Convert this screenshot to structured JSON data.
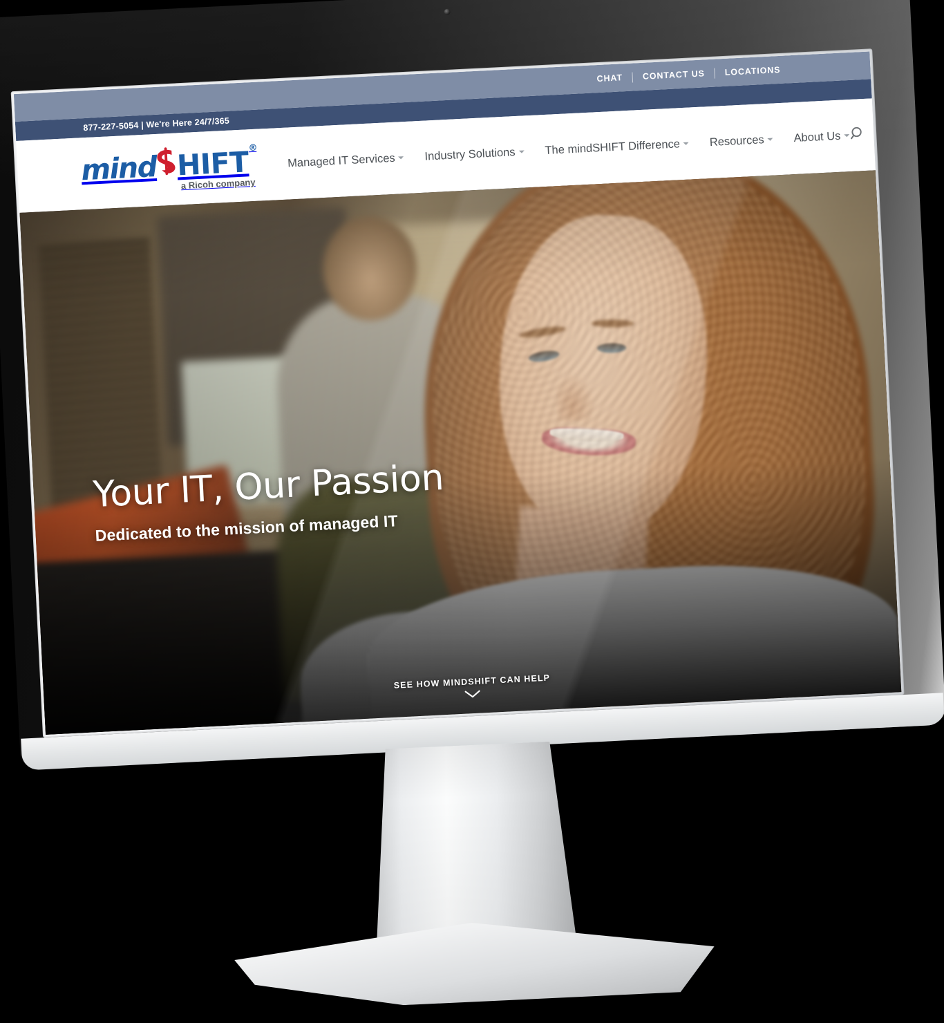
{
  "device": {
    "type": "desktop-monitor-mockup",
    "webcam_label": "webcam"
  },
  "utility_bar": {
    "background": "#7f8da6",
    "links": [
      {
        "label": "CHAT",
        "name": "chat"
      },
      {
        "label": "CONTACT US",
        "name": "contact-us"
      },
      {
        "label": "LOCATIONS",
        "name": "locations"
      }
    ]
  },
  "phone_bar": {
    "background": "#3e5175",
    "text": "877-227-5054 | We're Here 24/7/365",
    "phone": "877-227-5054",
    "hours": "We're Here 24/7/365"
  },
  "logo": {
    "word_part1": "mind",
    "word_part2": "HIFT",
    "registered_mark": "®",
    "tagline": "a Ricoh company",
    "brand_blue": "#1c5da5",
    "brand_red": "#cf1f2e",
    "swoosh_icon": "mindshift-swoosh-icon"
  },
  "nav": {
    "items": [
      {
        "label": "Managed IT Services",
        "has_dropdown": true,
        "name": "managed-it-services"
      },
      {
        "label": "Industry Solutions",
        "has_dropdown": true,
        "name": "industry-solutions"
      },
      {
        "label": "The mindSHIFT Difference",
        "has_dropdown": true,
        "name": "mindshift-difference"
      },
      {
        "label": "Resources",
        "has_dropdown": true,
        "name": "resources"
      },
      {
        "label": "About Us",
        "has_dropdown": true,
        "name": "about-us"
      }
    ],
    "search_icon": "search-icon"
  },
  "hero": {
    "title": "Your IT, Our Passion",
    "subtitle": "Dedicated to the mission of managed IT",
    "cta_text": "SEE HOW MINDSHIFT CAN HELP",
    "cta_icon": "chevron-down-icon",
    "image_description": "Smiling woman with curly auburn hair at a desk in a blurred open-plan office"
  }
}
